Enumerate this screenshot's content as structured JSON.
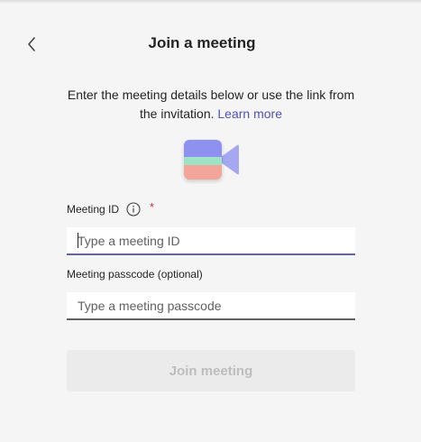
{
  "dialog": {
    "title": "Join a meeting",
    "description": "Enter the meeting details below or use the link from the invitation.",
    "learn_more": "Learn more"
  },
  "icons": {
    "back": "chevron-left-icon",
    "camera": "video-camera-icon",
    "info": "info-icon"
  },
  "meeting_id": {
    "label": "Meeting ID",
    "required_mark": "*",
    "placeholder": "Type a meeting ID",
    "value": ""
  },
  "passcode": {
    "label": "Meeting passcode (optional)",
    "placeholder": "Type a meeting passcode",
    "value": ""
  },
  "join_button": {
    "label": "Join meeting",
    "enabled": false
  },
  "colors": {
    "accent": "#6264a7",
    "link": "#4f52b2",
    "required": "#c4314b",
    "background": "#f5f5f5",
    "disabled_button": "#ebebeb"
  }
}
